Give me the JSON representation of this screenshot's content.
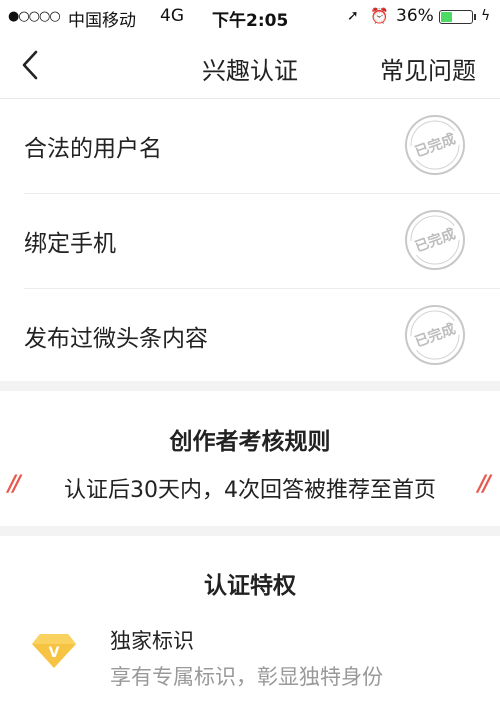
{
  "status_bar": {
    "signal": "●○○○○",
    "carrier": "中国移动",
    "network": "4G",
    "time": "下午2:05",
    "battery_pct": "36%",
    "battery_level": 0.36,
    "icons": [
      "location-arrow-icon",
      "alarm-clock-icon",
      "battery-icon",
      "charging-bolt-icon"
    ]
  },
  "nav": {
    "back_icon": "chevron-left-icon",
    "title": "兴趣认证",
    "faq": "常见问题"
  },
  "requirements": [
    {
      "label": "合法的用户名",
      "stamp": "已完成"
    },
    {
      "label": "绑定手机",
      "stamp": "已完成"
    },
    {
      "label": "发布过微头条内容",
      "stamp": "已完成"
    }
  ],
  "rules": {
    "title": "创作者考核规则",
    "mark": "//",
    "text": "认证后30天内，4次回答被推荐至首页",
    "accent_color": "#e85a4f"
  },
  "privileges": {
    "title": "认证特权",
    "items": [
      {
        "icon": "diamond-v-badge-icon",
        "name": "独家标识",
        "desc": "享有专属标识，彰显独特身份"
      }
    ]
  }
}
